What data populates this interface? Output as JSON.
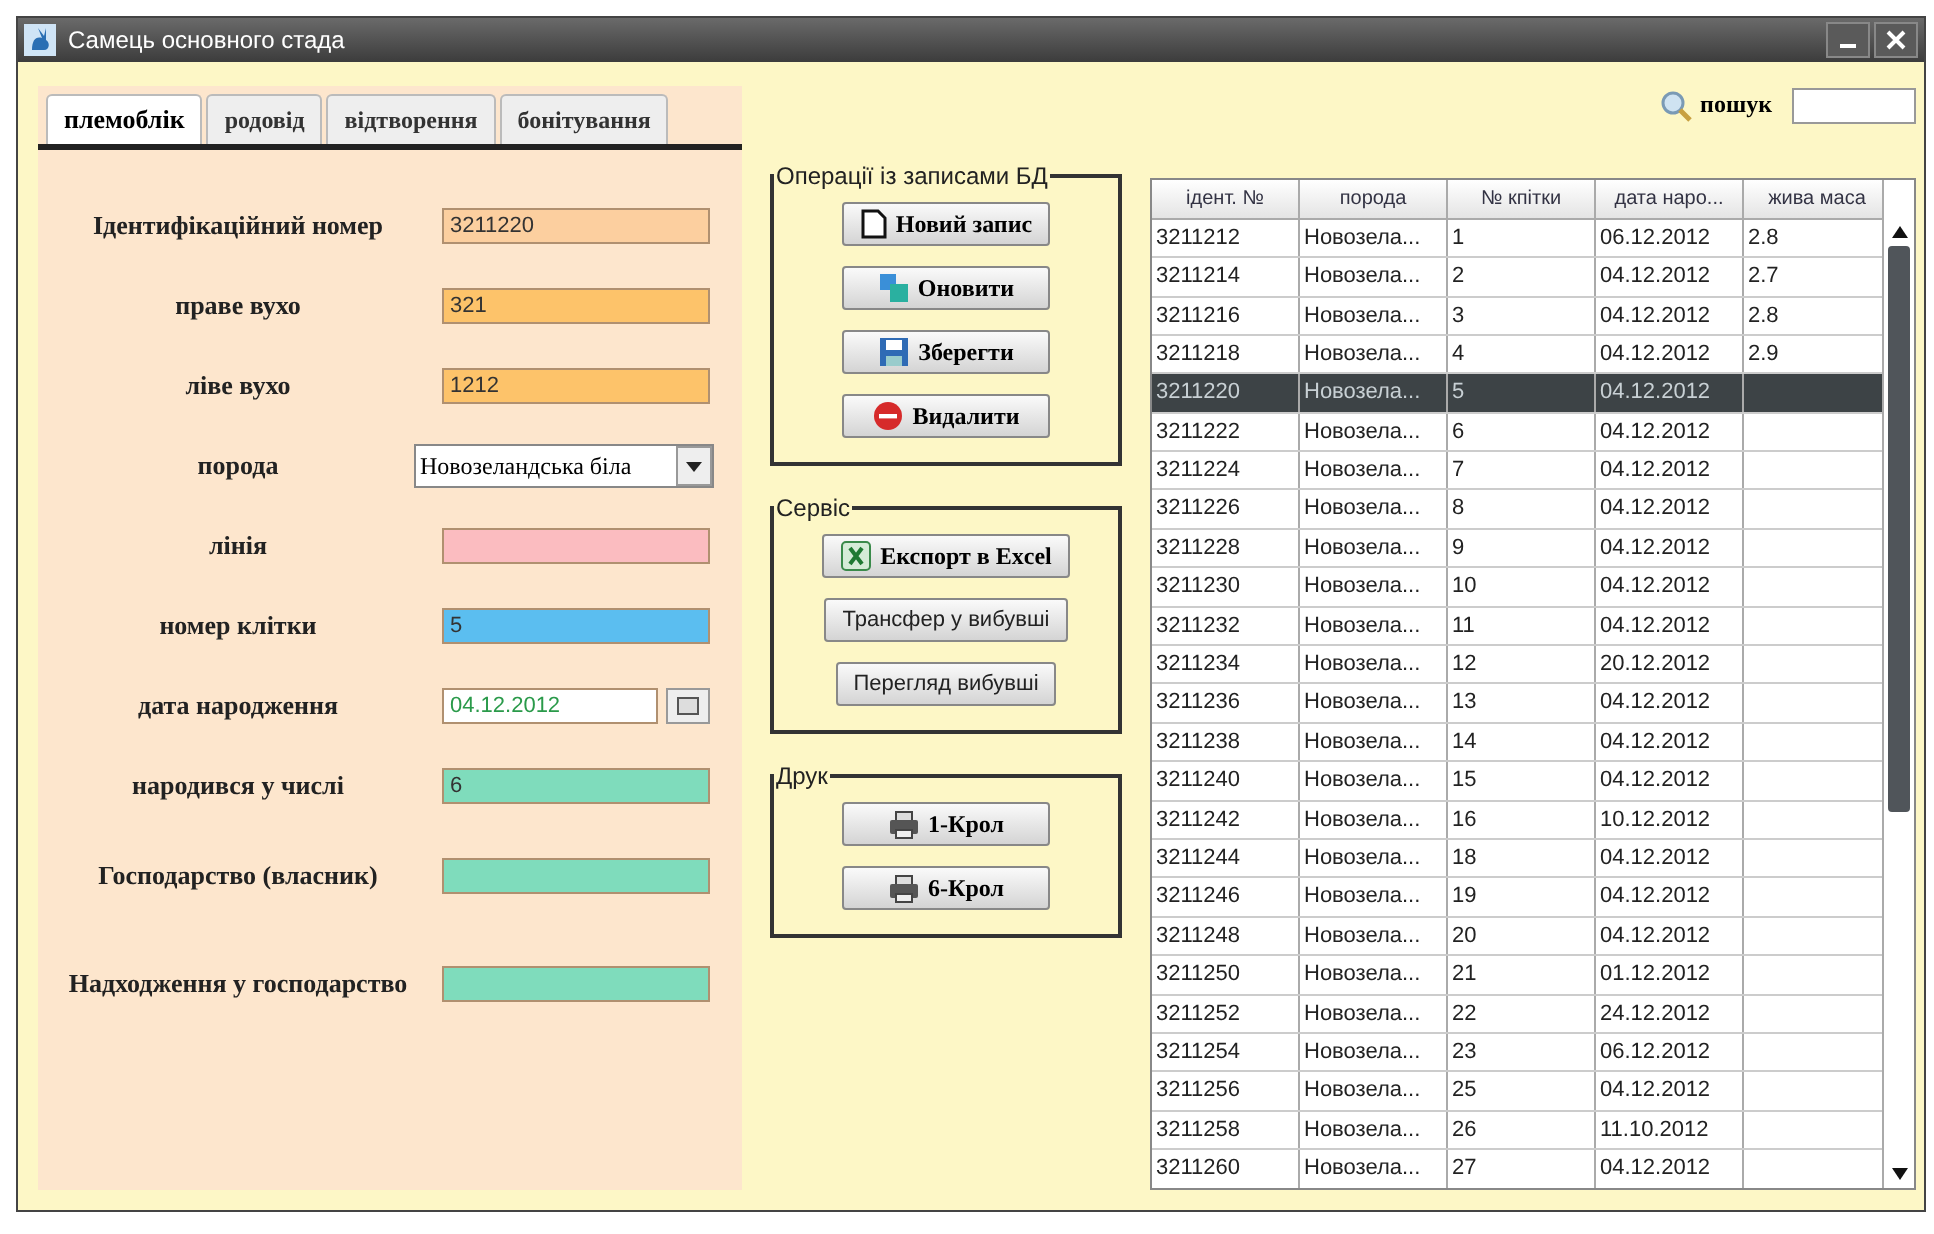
{
  "window": {
    "title": "Самець основного стада"
  },
  "tabs": [
    {
      "label": "племоблік",
      "selected": true
    },
    {
      "label": "родовід",
      "selected": false
    },
    {
      "label": "відтворення",
      "selected": false
    },
    {
      "label": "бонітування",
      "selected": false
    }
  ],
  "fields": [
    {
      "label": "Ідентифікаційний номер",
      "kind": "text",
      "value": "3211220",
      "color": "#fccf9f"
    },
    {
      "label": "праве вухо",
      "kind": "text",
      "value": "321",
      "color": "#fdc36a"
    },
    {
      "label": "ліве вухо",
      "kind": "text",
      "value": "1212",
      "color": "#fdc36a"
    },
    {
      "label": "порода",
      "kind": "combo",
      "value": "Новозеландська біла",
      "color": "#ffffff"
    },
    {
      "label": "лінія",
      "kind": "text",
      "color": "#fbbcc0"
    },
    {
      "label": "номер клітки",
      "kind": "text",
      "value": "5",
      "color": "#5bbef0"
    },
    {
      "label": "дата народження",
      "kind": "date",
      "value": "04.12.2012",
      "color": "#ffffff"
    },
    {
      "label": "народився у числі",
      "kind": "text",
      "value": "6",
      "color": "#7fdcbc"
    },
    {
      "label": "Господарство (власник)",
      "kind": "text",
      "color": "#7fdcbc"
    },
    {
      "label": "Надходження у господарство",
      "kind": "text",
      "color": "#7fdcbc"
    }
  ],
  "groups": [
    {
      "title": "Операції із записами БД",
      "buttons": [
        {
          "label": "Новий запис",
          "kind": "page"
        },
        {
          "label": "Оновити",
          "kind": "refresh"
        },
        {
          "label": "Зберегти",
          "kind": "disk"
        },
        {
          "label": "Видалити",
          "kind": "delete"
        }
      ]
    },
    {
      "title": "Сервіс",
      "buttons": [
        {
          "label": "Експорт в Excel",
          "kind": "spreadsheet"
        },
        {
          "label": "Трансфер у вибувші",
          "kind": "plain"
        },
        {
          "label": "Перегляд вибувші",
          "kind": "plain"
        }
      ]
    },
    {
      "title": "Друк",
      "buttons": [
        {
          "label": "1-Крол",
          "kind": "printer"
        },
        {
          "label": "6-Крол",
          "kind": "printer"
        }
      ]
    }
  ],
  "search": {
    "label": "пошук"
  },
  "table": {
    "columns": [
      "ідент. №",
      "порода",
      "№ кпітки",
      "дата наро...",
      "жива маса"
    ],
    "rows": [
      {
        "cells": [
          "3211212",
          "Новозела...",
          "1",
          "06.12.2012",
          "2.8"
        ],
        "selected": false
      },
      {
        "cells": [
          "3211214",
          "Новозела...",
          "2",
          "04.12.2012",
          "2.7"
        ],
        "selected": false
      },
      {
        "cells": [
          "3211216",
          "Новозела...",
          "3",
          "04.12.2012",
          "2.8"
        ],
        "selected": false
      },
      {
        "cells": [
          "3211218",
          "Новозела...",
          "4",
          "04.12.2012",
          "2.9"
        ],
        "selected": false
      },
      {
        "cells": [
          "3211220",
          "Новозела...",
          "5",
          "04.12.2012",
          ""
        ],
        "selected": true
      },
      {
        "cells": [
          "3211222",
          "Новозела...",
          "6",
          "04.12.2012",
          ""
        ],
        "selected": false
      },
      {
        "cells": [
          "3211224",
          "Новозела...",
          "7",
          "04.12.2012",
          ""
        ],
        "selected": false
      },
      {
        "cells": [
          "3211226",
          "Новозела...",
          "8",
          "04.12.2012",
          ""
        ],
        "selected": false
      },
      {
        "cells": [
          "3211228",
          "Новозела...",
          "9",
          "04.12.2012",
          ""
        ],
        "selected": false
      },
      {
        "cells": [
          "3211230",
          "Новозела...",
          "10",
          "04.12.2012",
          ""
        ],
        "selected": false
      },
      {
        "cells": [
          "3211232",
          "Новозела...",
          "11",
          "04.12.2012",
          ""
        ],
        "selected": false
      },
      {
        "cells": [
          "3211234",
          "Новозела...",
          "12",
          "20.12.2012",
          ""
        ],
        "selected": false
      },
      {
        "cells": [
          "3211236",
          "Новозела...",
          "13",
          "04.12.2012",
          ""
        ],
        "selected": false
      },
      {
        "cells": [
          "3211238",
          "Новозела...",
          "14",
          "04.12.2012",
          ""
        ],
        "selected": false
      },
      {
        "cells": [
          "3211240",
          "Новозела...",
          "15",
          "04.12.2012",
          ""
        ],
        "selected": false
      },
      {
        "cells": [
          "3211242",
          "Новозела...",
          "16",
          "10.12.2012",
          ""
        ],
        "selected": false
      },
      {
        "cells": [
          "3211244",
          "Новозела...",
          "18",
          "04.12.2012",
          ""
        ],
        "selected": false
      },
      {
        "cells": [
          "3211246",
          "Новозела...",
          "19",
          "04.12.2012",
          ""
        ],
        "selected": false
      },
      {
        "cells": [
          "3211248",
          "Новозела...",
          "20",
          "04.12.2012",
          ""
        ],
        "selected": false
      },
      {
        "cells": [
          "3211250",
          "Новозела...",
          "21",
          "01.12.2012",
          ""
        ],
        "selected": false
      },
      {
        "cells": [
          "3211252",
          "Новозела...",
          "22",
          "24.12.2012",
          ""
        ],
        "selected": false
      },
      {
        "cells": [
          "3211254",
          "Новозела...",
          "23",
          "06.12.2012",
          ""
        ],
        "selected": false
      },
      {
        "cells": [
          "3211256",
          "Новозела...",
          "25",
          "04.12.2012",
          ""
        ],
        "selected": false
      },
      {
        "cells": [
          "3211258",
          "Новозела...",
          "26",
          "11.10.2012",
          ""
        ],
        "selected": false
      },
      {
        "cells": [
          "3211260",
          "Новозела...",
          "27",
          "04.12.2012",
          ""
        ],
        "selected": false
      }
    ]
  }
}
